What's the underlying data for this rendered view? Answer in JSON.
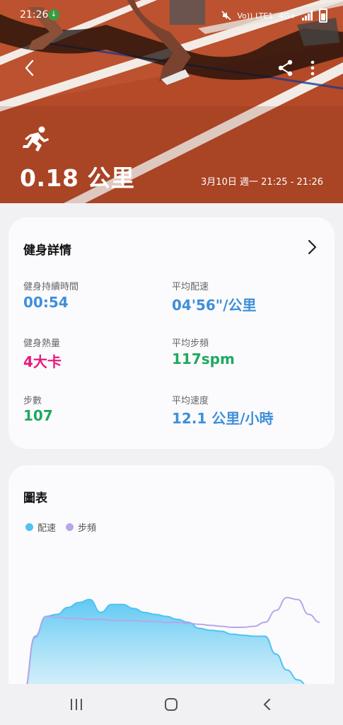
{
  "status_bar": {
    "time": "21:26",
    "network_label": "Vo)) LTE1",
    "signal_label": "4G+"
  },
  "hero": {
    "distance": "0.18 公里",
    "datetime": "3月10日 週一 21:25 - 21:26",
    "activity_icon": "running-icon"
  },
  "details": {
    "title": "健身詳情",
    "metrics": [
      {
        "label": "健身持續時間",
        "value": "00:54",
        "color": "#3f8fd9"
      },
      {
        "label": "平均配速",
        "value": "04'56\"/公里",
        "color": "#3f8fd9"
      },
      {
        "label": "健身熱量",
        "value": "4大卡",
        "color": "#e8197c"
      },
      {
        "label": "平均步頻",
        "value": "117spm",
        "color": "#1fa860"
      },
      {
        "label": "步數",
        "value": "107",
        "color": "#1fa860"
      },
      {
        "label": "平均速度",
        "value": "12.1 公里/小時",
        "color": "#3f8fd9"
      }
    ]
  },
  "chart": {
    "title": "圖表",
    "legend": [
      {
        "label": "配速",
        "color": "#4fc3f0"
      },
      {
        "label": "步頻",
        "color": "#b9a5ea"
      }
    ]
  },
  "chart_data": {
    "type": "area",
    "title": "圖表",
    "series": [
      {
        "name": "配速",
        "values": [
          0.0,
          0.55,
          0.76,
          0.78,
          0.85,
          0.9,
          0.93,
          0.8,
          0.88,
          0.88,
          0.84,
          0.8,
          0.78,
          0.76,
          0.73,
          0.7,
          0.64,
          0.62,
          0.61,
          0.58,
          0.57,
          0.56,
          0.56,
          0.38,
          0.22,
          0.12,
          0.05,
          0.04
        ]
      },
      {
        "name": "步頻",
        "values": [
          0.0,
          0.56,
          0.76,
          0.75,
          0.74,
          0.74,
          0.73,
          0.73,
          0.72,
          0.72,
          0.72,
          0.71,
          0.71,
          0.7,
          0.7,
          0.69,
          0.68,
          0.67,
          0.66,
          0.65,
          0.65,
          0.66,
          0.7,
          0.82,
          0.95,
          0.93,
          0.78,
          0.7
        ]
      }
    ]
  },
  "navbar": {
    "recent_icon": "recent-apps-icon",
    "home_icon": "home-icon",
    "back_icon": "back-icon"
  }
}
